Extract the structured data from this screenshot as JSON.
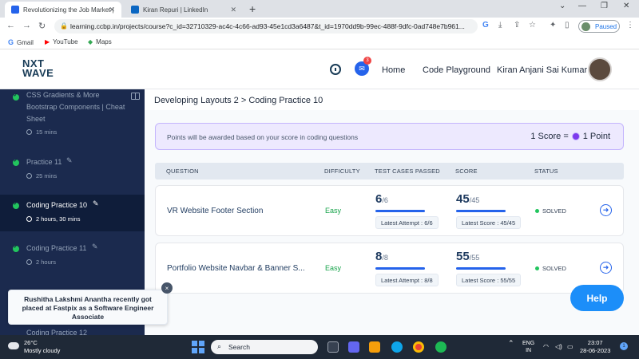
{
  "browser": {
    "tabs": [
      {
        "label": "Revolutionizing the Job Market |"
      },
      {
        "label": "Kiran Repuri | LinkedIn"
      }
    ],
    "new_tab": "+",
    "url": "learning.ccbp.in/projects/course?c_id=32710329-ac4c-4c66-ad93-45e1cd3a6487&t_id=1970dd9b-99ec-488f-9dfc-0ad748e7b961...",
    "profile_status": "Paused",
    "bookmarks": [
      {
        "label": "Gmail"
      },
      {
        "label": "YouTube"
      },
      {
        "label": "Maps"
      }
    ]
  },
  "header": {
    "logo_line1": "NXT",
    "logo_line2": "WAVE",
    "chat_badge": "3",
    "nav": [
      {
        "label": "Home"
      },
      {
        "label": "Code Playground"
      }
    ],
    "user_name": "Kiran Anjani Sai Kumar"
  },
  "sidebar": {
    "items": [
      {
        "title": "CSS Gradients & More Bootstrap Components | Cheat Sheet",
        "duration": "15 mins"
      },
      {
        "title": "Practice 11",
        "duration": "25 mins"
      },
      {
        "title": "Coding Practice 10",
        "duration": "2 hours, 30 mins"
      },
      {
        "title": "Coding Practice 11",
        "duration": "2 hours"
      },
      {
        "title": "Coding Practice 12",
        "duration": ""
      }
    ]
  },
  "main": {
    "breadcrumb": "Developing Layouts 2 > Coding Practice 10",
    "points_message": "Points will be awarded based on your score in coding questions",
    "score_left": "1 Score =",
    "score_right": "1 Point",
    "columns": [
      "QUESTION",
      "DIFFICULTY",
      "TEST CASES PASSED",
      "SCORE",
      "STATUS"
    ],
    "rows": [
      {
        "question": "VR Website Footer Section",
        "difficulty": "Easy",
        "tests_passed": "6",
        "tests_total": "/6",
        "latest_attempt": "Latest Attempt : 6/6",
        "score": "45",
        "score_total": "/45",
        "latest_score": "Latest Score : 45/45",
        "status": "SOLVED"
      },
      {
        "question": "Portfolio Website Navbar & Banner S...",
        "difficulty": "Easy",
        "tests_passed": "8",
        "tests_total": "/8",
        "latest_attempt": "Latest Attempt : 8/8",
        "score": "55",
        "score_total": "/55",
        "latest_score": "Latest Score : 55/55",
        "status": "SOLVED"
      }
    ]
  },
  "help_label": "Help",
  "toast": {
    "message": "Rushitha Lakshmi Anantha recently got placed at Fastpix as a Software Engineer Associate",
    "close": "×"
  },
  "taskbar": {
    "temperature": "26°C",
    "weather": "Mostly cloudy",
    "search_label": "Search",
    "lang1": "ENG",
    "lang2": "IN",
    "time": "23:07",
    "date": "28-06-2023",
    "notifications": "1"
  },
  "colors": {
    "sidebar_bg": "#1b2a4e",
    "accent_blue": "#2563eb",
    "easy_green": "#16a34a",
    "points_bg": "#ede9fe",
    "help_blue": "#1c8ef9"
  }
}
